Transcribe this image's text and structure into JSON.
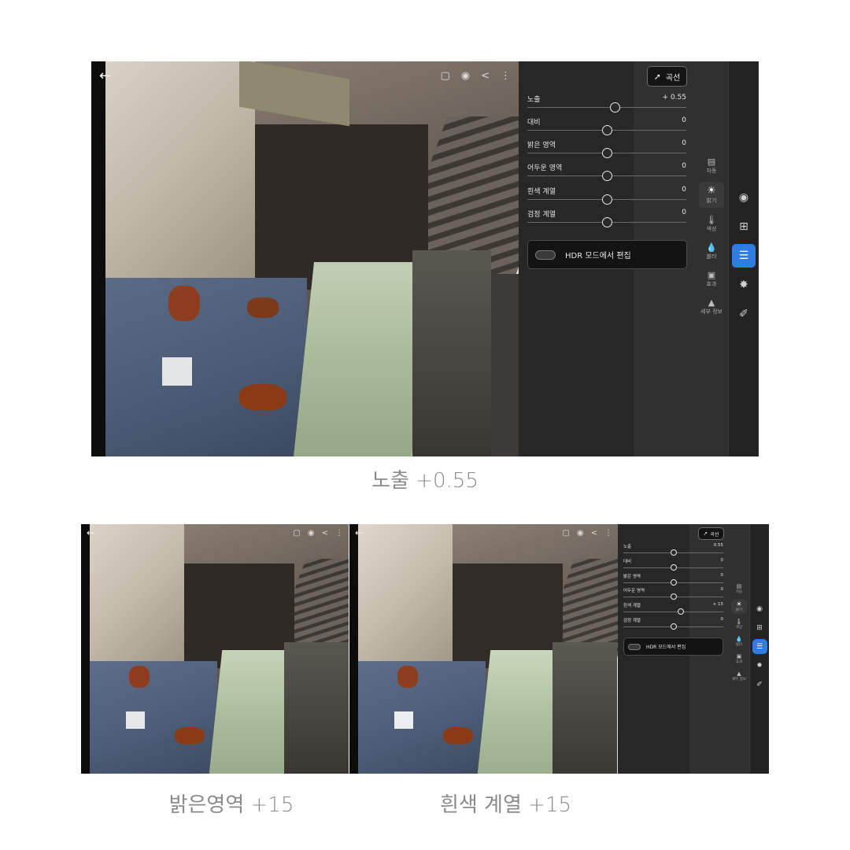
{
  "captions": {
    "top": "노출 +0.55",
    "bottom_left": "밝은영역 +15",
    "bottom_right": "흰색 계열 +15"
  },
  "editor_main": {
    "curve_button": "곡선",
    "sliders": [
      {
        "label": "노출",
        "value": "+ 0.55",
        "position": 0.55
      },
      {
        "label": "대비",
        "value": "0",
        "position": 0.5
      },
      {
        "label": "밝은 영역",
        "value": "0",
        "position": 0.5
      },
      {
        "label": "어두운 영역",
        "value": "0",
        "position": 0.5
      },
      {
        "label": "흰색 계열",
        "value": "0",
        "position": 0.5
      },
      {
        "label": "검정 계열",
        "value": "0",
        "position": 0.5
      }
    ],
    "hdr_label": "HDR 모드에서 편집",
    "subnav": [
      {
        "icon": "auto-icon",
        "label": "자동"
      },
      {
        "icon": "brightness-icon",
        "label": "밝기",
        "active": true
      },
      {
        "icon": "color-icon",
        "label": "색상"
      },
      {
        "icon": "blur-icon",
        "label": "블러"
      },
      {
        "icon": "effects-icon",
        "label": "효과"
      },
      {
        "icon": "detail-icon",
        "label": "세부 정보"
      }
    ]
  },
  "editor_small": {
    "curve_button": "곡선",
    "sliders": [
      {
        "label": "노출",
        "value": "0.55",
        "position": 0.55
      },
      {
        "label": "대비",
        "value": "0",
        "position": 0.5
      },
      {
        "label": "밝은 영역",
        "value": "0",
        "position": 0.5
      },
      {
        "label": "어두운 영역",
        "value": "0",
        "position": 0.5
      },
      {
        "label": "흰색 계열",
        "value": "+ 15",
        "position": 0.58
      },
      {
        "label": "검정 계열",
        "value": "0",
        "position": 0.5
      }
    ],
    "hdr_label": "HDR 모드에서 편집",
    "subnav": [
      {
        "icon": "auto-icon",
        "label": "자동"
      },
      {
        "icon": "brightness-icon",
        "label": "밝기",
        "active": true
      },
      {
        "icon": "color-icon",
        "label": "색상"
      },
      {
        "icon": "blur-icon",
        "label": "블러"
      },
      {
        "icon": "effects-icon",
        "label": "효과"
      },
      {
        "icon": "detail-icon",
        "label": "세부 정보"
      }
    ]
  },
  "colors": {
    "accent": "#2d7de3",
    "panel": "#272727",
    "caption": "#8a8a8a"
  }
}
